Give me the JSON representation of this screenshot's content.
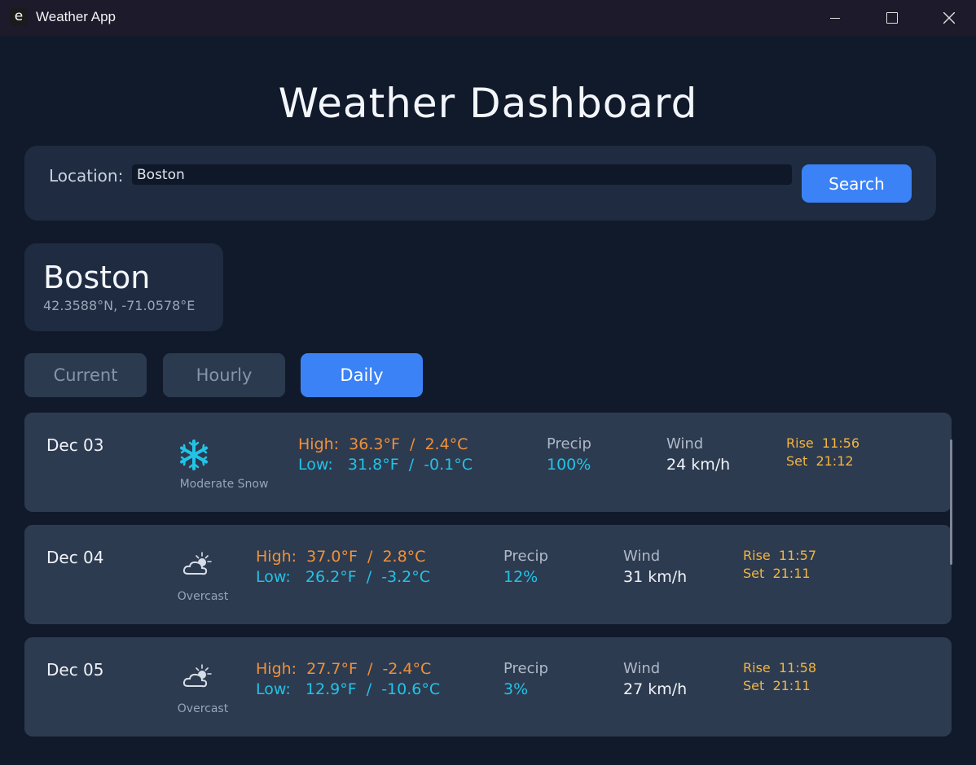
{
  "window": {
    "app_icon_letter": "e",
    "title": "Weather App"
  },
  "header": {
    "title": "Weather Dashboard"
  },
  "search": {
    "label": "Location:",
    "value": "Boston",
    "button_label": "Search"
  },
  "city": {
    "name": "Boston",
    "coords": "42.3588°N, -71.0578°E"
  },
  "tabs": [
    {
      "label": "Current",
      "active": false
    },
    {
      "label": "Hourly",
      "active": false
    },
    {
      "label": "Daily",
      "active": true
    }
  ],
  "days": [
    {
      "date": "Dec 03",
      "icon": "snowflake-icon",
      "condition": "Moderate Snow",
      "high": "High:  36.3°F  /  2.4°C",
      "low": "Low:   31.8°F  /  -0.1°C",
      "precip_label": "Precip",
      "precip": "100%",
      "wind_label": "Wind",
      "wind": "24  km/h",
      "rise": "Rise  11:56",
      "set": "Set  21:12"
    },
    {
      "date": "Dec 04",
      "icon": "partly-cloudy-icon",
      "condition": "Overcast",
      "high": "High:  37.0°F  /  2.8°C",
      "low": "Low:   26.2°F  /  -3.2°C",
      "precip_label": "Precip",
      "precip": "12%",
      "wind_label": "Wind",
      "wind": "31  km/h",
      "rise": "Rise  11:57",
      "set": "Set  21:11"
    },
    {
      "date": "Dec 05",
      "icon": "partly-cloudy-icon",
      "condition": "Overcast",
      "high": "High:  27.7°F  /  -2.4°C",
      "low": "Low:   12.9°F  /  -10.6°C",
      "precip_label": "Precip",
      "precip": "3%",
      "wind_label": "Wind",
      "wind": "27  km/h",
      "rise": "Rise  11:58",
      "set": "Set  21:11"
    }
  ],
  "colors": {
    "accent": "#3b82f6",
    "high": "#f0913a",
    "low": "#22c3e6",
    "sun": "#f4b53f",
    "background": "#111a2b",
    "card": "#2d3b50"
  }
}
